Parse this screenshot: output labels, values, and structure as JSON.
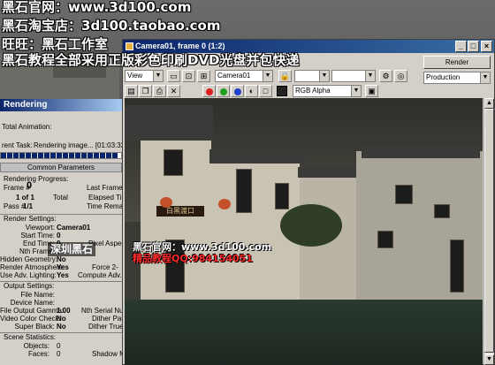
{
  "watermarks": {
    "line1": "黑石官网：www.3d100.com",
    "line2": "黑石淘宝店：3d100.taobao.com",
    "line3": "旺旺：黑石工作室",
    "line4": "黑石教程全部采用正版彩色印刷DVD光盘并包快递",
    "center_line1": "黑石官网：www.3d100.com",
    "center_line2": "精品教程QQ:984154051",
    "left_banner": "深圳黑石"
  },
  "render_dialog": {
    "title": "Rendering",
    "total_animation_label": "Total Animation:",
    "current_task_label": "rent Task:",
    "current_task_value": "Rendering image... [01:03:32.9] [01:03:32.9]",
    "progress_fraction": 0.97,
    "section_common": "Common Parameters",
    "rendering_progress_label": "Rendering Progress:",
    "frame_label": "Frame #",
    "frame_value": "0",
    "last_frame_time": "Last Frame Tir",
    "of_label": "1 of 1",
    "total_label": "Total",
    "elapsed_label": "Elapsed Ti",
    "pass_label": "Pass #",
    "pass_value": "1/1",
    "time_remaining": "Time Remaini",
    "render_settings_label": "Render Settings:",
    "viewport_label": "Viewport:",
    "viewport_value": "Camera01",
    "start_time_label": "Start Time:",
    "start_time_value": "0",
    "end_time_label": "End Time:",
    "end_time_value": "0",
    "nth_frame_label": "Nth Frame:",
    "nth_frame_value": "1",
    "hidden_geo_label": "Hidden Geometry:",
    "hidden_geo_value": "No",
    "render_atmos_label": "Render Atmosphere:",
    "render_atmos_value": "Yes",
    "use_adv_lighting_label": "Use Adv. Lighting:",
    "use_adv_lighting_value": "Yes",
    "pixel_aspect": "Pixel Aspect",
    "force2": "Force 2-",
    "compute_adv": "Compute Adv. Lig",
    "output_settings_label": "Output Settings:",
    "file_name_label": "File Name:",
    "device_name_label": "Device Name:",
    "gamma_label": "File Output Gamma:",
    "gamma_value": "1.00",
    "nth_serial": "Nth Serial Numb",
    "video_color_label": "Video Color Check:",
    "video_color_value": "No",
    "dither_pa": "Dither Pal",
    "super_black_label": "Super Black:",
    "super_black_value": "No",
    "dither_tr": "Dither True",
    "scene_stats_label": "Scene Statistics:",
    "objects_label": "Objects:",
    "objects_value": "0",
    "faces_label": "Faces:",
    "faces_value": "0",
    "shadow_m": "Shadow M"
  },
  "vfb": {
    "title": "Camera01, frame 0 (1:2)",
    "area_select": "View",
    "viewport_select": "Camera01",
    "channel_select": "RGB Alpha",
    "render_button": "Render",
    "preset_select": "Production",
    "sign_text": "白黑渡口",
    "colors": {
      "red": "#e02020",
      "green": "#20a020",
      "blue": "#2040d0",
      "mono": "#ffffff"
    }
  }
}
